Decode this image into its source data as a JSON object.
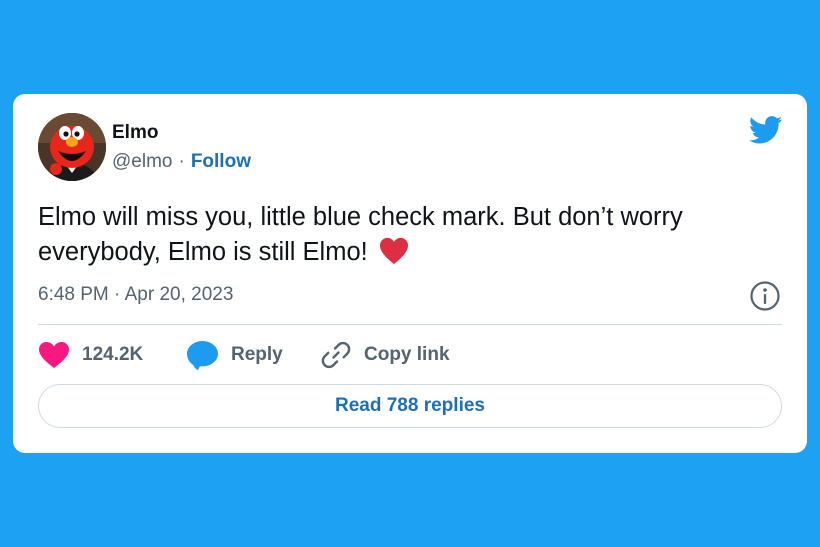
{
  "colors": {
    "background": "#1da1f2",
    "card": "#ffffff",
    "link": "#1d6fb8",
    "like": "#f91880",
    "reply": "#1d9bf0",
    "text": "#0f1419",
    "muted": "#536471"
  },
  "author": {
    "name": "Elmo",
    "handle": "@elmo",
    "separator": "·",
    "follow_label": "Follow",
    "avatar_icon": "elmo-avatar"
  },
  "brand_icon": "twitter-bird-icon",
  "tweet": {
    "text": "Elmo will miss you, little blue check mark. But don’t worry everybody, Elmo is still Elmo!",
    "emoji": "red-heart-emoji",
    "timestamp": "6:48 PM · Apr 20, 2023",
    "info_icon": "info-icon"
  },
  "actions": {
    "likes_count": "124.2K",
    "reply_label": "Reply",
    "copy_link_label": "Copy link"
  },
  "replies_button": {
    "label": "Read 788 replies"
  }
}
